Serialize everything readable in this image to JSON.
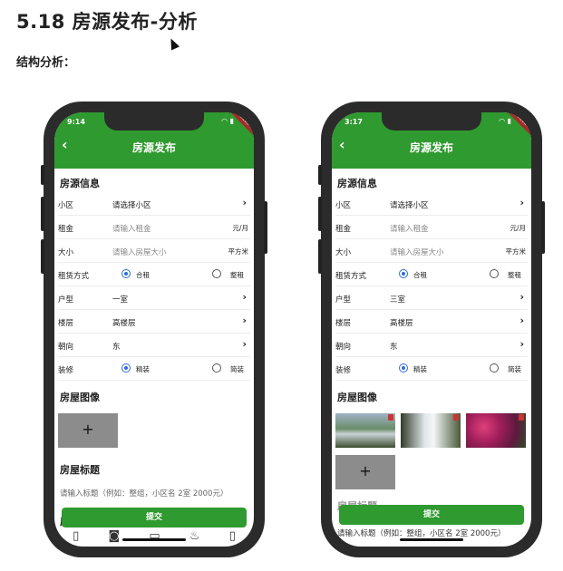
{
  "doc": {
    "title": "5.18 房源发布-分析",
    "subtitle": "结构分析："
  },
  "phones": [
    {
      "time": "9:14",
      "title": "房源发布",
      "debug": "DEBUG",
      "section_info": "房源信息",
      "rows": [
        {
          "label": "小区",
          "value": "请选择小区"
        },
        {
          "label": "租金",
          "placeholder": "请输入租金",
          "unit": "元/月"
        },
        {
          "label": "大小",
          "placeholder": "请输入房屋大小",
          "unit": "平方米"
        },
        {
          "label": "租赁方式",
          "opt1": "合租",
          "opt2": "整租"
        },
        {
          "label": "户型",
          "value": "一室"
        },
        {
          "label": "楼层",
          "value": "高楼层"
        },
        {
          "label": "朝向",
          "value": "东"
        },
        {
          "label": "装修",
          "opt1": "精装",
          "opt2": "简装"
        }
      ],
      "section_images": "房屋图像",
      "add": "+",
      "section_title": "房屋标题",
      "title_hint": "请输入标题（例如：整组，小区名 2室 2000元）",
      "section_next": "房",
      "submit": "提交"
    },
    {
      "time": "3:17",
      "title": "房源发布",
      "debug": "DEBUG",
      "section_info": "房源信息",
      "rows": [
        {
          "label": "小区",
          "value": "请选择小区"
        },
        {
          "label": "租金",
          "placeholder": "请输入租金",
          "unit": "元/月"
        },
        {
          "label": "大小",
          "placeholder": "请输入房屋大小",
          "unit": "平方米"
        },
        {
          "label": "租赁方式",
          "opt1": "合租",
          "opt2": "整租"
        },
        {
          "label": "户型",
          "value": "三室"
        },
        {
          "label": "楼层",
          "value": "高楼层"
        },
        {
          "label": "朝向",
          "value": "东"
        },
        {
          "label": "装修",
          "opt1": "精装",
          "opt2": "简装"
        }
      ],
      "section_images": "房屋图像",
      "add": "+",
      "section_title": "房屋标题",
      "title_hint": "请输入标题（例如：整组，小区名 2室 2000元）",
      "submit": "提交"
    }
  ],
  "colors": {
    "appbar": "#2f9a2f",
    "radio": "#2b6fd6",
    "add_box": "#8c8c8c"
  }
}
